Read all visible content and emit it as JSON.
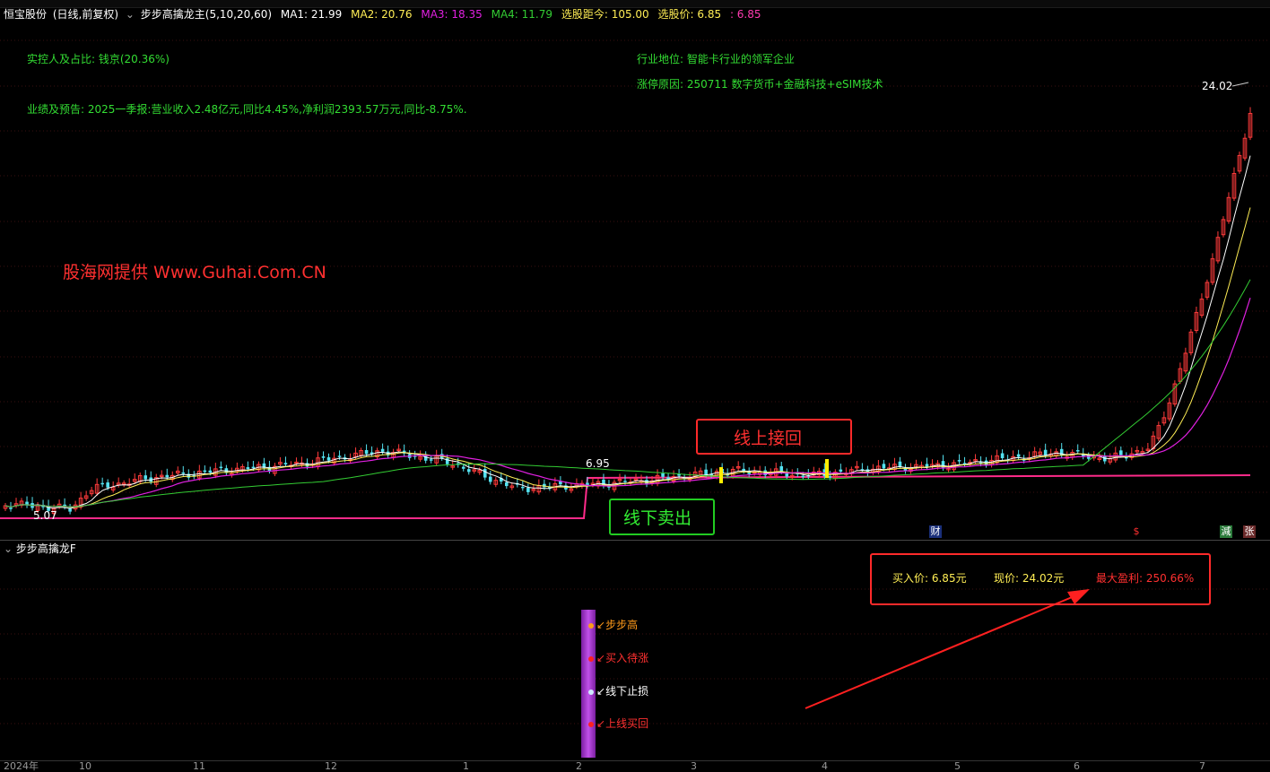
{
  "header": {
    "stock": "恒宝股份",
    "period": "(日线,前复权)",
    "indicator": "步步高擒龙主",
    "params": "(5,10,20,60)",
    "ma1_label": "MA1: 21.99",
    "ma2_label": "MA2: 20.76",
    "ma3_label": "MA3: 18.35",
    "ma4_label": "MA4: 11.79",
    "dist_label": "选股距今: 105.00",
    "price_label": "选股价: 6.85",
    "extra_label": ": 6.85"
  },
  "info": {
    "controller": "实控人及占比: 钱京(20.36%)",
    "earnings": "业绩及预告: 2025一季报:营业收入2.48亿元,同比4.45%,净利润2393.57万元,同比-8.75%.",
    "industry": "行业地位: 智能卡行业的领军企业",
    "limit_up": "涨停原因: 250711 数字货币+金融科技+eSIM技术"
  },
  "watermark": "股海网提供 Www.Guhai.Com.CN",
  "price_labels": {
    "high": "24.02",
    "low": "5.07",
    "mid": "6.95"
  },
  "annotations": {
    "above": "线上接回",
    "below": "线下卖出"
  },
  "tags": {
    "cai": "财",
    "s": "$",
    "jian": "減",
    "zhang": "张"
  },
  "sub": {
    "title": "步步高擒龙F",
    "buy": "买入价: 6.85元",
    "now": "现价: 24.02元",
    "profit": "最大盈利: 250.66%",
    "sig1": "步步高",
    "sig2": "买入待涨",
    "sig3": "线下止损",
    "sig4": "上线买回"
  },
  "xaxis": {
    "year": "2024年",
    "m10": "10",
    "m11": "11",
    "m12": "12",
    "m1": "1",
    "m2": "2",
    "m3": "3",
    "m4": "4",
    "m5": "5",
    "m6": "6",
    "m7": "7"
  },
  "colors": {
    "up": "#ff3b3b",
    "down": "#54e2f0",
    "ma1": "#ffffff",
    "ma2": "#ffee55",
    "ma3": "#e020e0",
    "ma4": "#33cc33",
    "stop": "#ff2b8a"
  },
  "chart_data": {
    "type": "candlestick",
    "price_range": [
      5.07,
      24.02
    ],
    "selection_price": 6.85,
    "ma_last": {
      "MA1": 21.99,
      "MA2": 20.76,
      "MA3": 18.35,
      "MA4": 11.79
    }
  }
}
